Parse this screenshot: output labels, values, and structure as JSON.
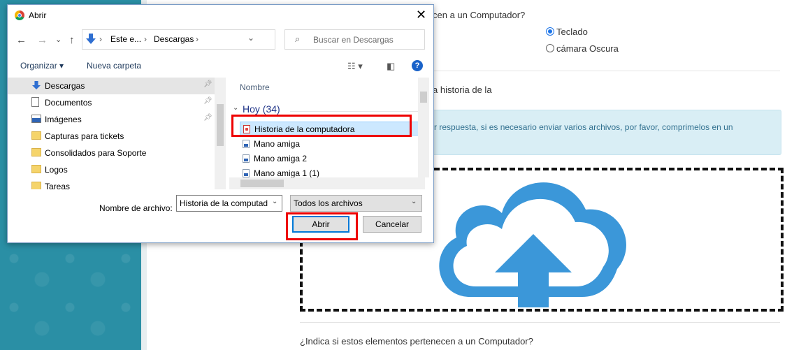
{
  "background": {
    "question_top": "cen a un Computador?",
    "option_1": "Teclado",
    "option_2": "cámara Oscura",
    "partial_history": "a historia de la",
    "info_text": "r respuesta, si es necesario enviar varios archivos, por favor, comprimelos en un",
    "question_bottom": "¿Indica si estos elementos pertenecen a un Computador?",
    "cloud_color": "#3b97d9"
  },
  "dialog": {
    "title": "Abrir",
    "close": "✕",
    "nav": {
      "back": "←",
      "forward": "→",
      "dropdown": "⌄",
      "up": "↑"
    },
    "address": {
      "part1": "Este e...",
      "sep": "›",
      "part2": "Descargas",
      "sep2": "›",
      "dropdown": "⌄"
    },
    "refresh": "↻",
    "search_placeholder": "Buscar en Descargas",
    "toolbar": {
      "organize": "Organizar ▾",
      "new_folder": "Nueva carpeta",
      "help": "?"
    },
    "sidebar": [
      {
        "label": "Descargas",
        "icon": "download-arrow-icon",
        "pinned": true,
        "selected": true
      },
      {
        "label": "Documentos",
        "icon": "document-icon",
        "pinned": true
      },
      {
        "label": "Imágenes",
        "icon": "image-icon",
        "pinned": true
      },
      {
        "label": "Capturas para tickets",
        "icon": "folder-icon"
      },
      {
        "label": "Consolidados para Soporte",
        "icon": "folder-icon"
      },
      {
        "label": "Logos",
        "icon": "folder-icon"
      },
      {
        "label": "Tareas",
        "icon": "folder-icon"
      }
    ],
    "files": {
      "column_header": "Nombre",
      "group": "Hoy (34)",
      "items": [
        {
          "label": "Historia de la computadora",
          "type": "pdf",
          "selected": true
        },
        {
          "label": "Mano amiga",
          "type": "image"
        },
        {
          "label": "Mano amiga 2",
          "type": "image"
        },
        {
          "label": "Mano amiga 1 (1)",
          "type": "image"
        }
      ]
    },
    "filename_label": "Nombre de archivo:",
    "filename_value": "Historia de la computad",
    "filetype_value": "Todos los archivos",
    "open_button": "Abrir",
    "cancel_button": "Cancelar",
    "highlight_color": "#e00000"
  }
}
